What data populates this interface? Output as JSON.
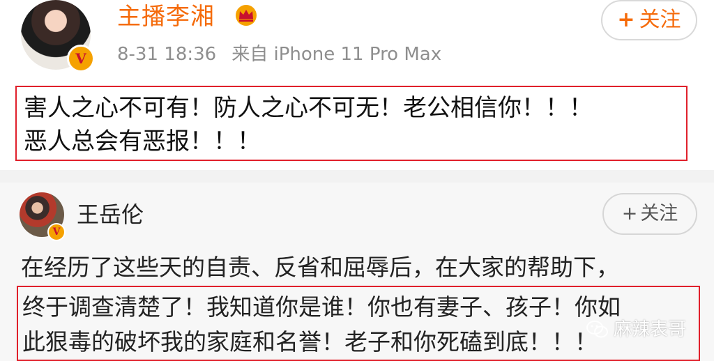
{
  "post1": {
    "username": "主播李湘",
    "date": "8-31 18:36",
    "source": "来自 iPhone 11 Pro Max",
    "follow_label": "关注",
    "follow_plus": "+",
    "badge_letter": "V",
    "text_lines": [
      "害人之心不可有！防人之心不可无！老公相信你！！！",
      "恶人总会有恶报！！！"
    ]
  },
  "post2": {
    "username": "王岳伦",
    "follow_label": "关注",
    "follow_plus": "+",
    "badge_letter": "V",
    "intro_line": "在经历了这些天的自责、反省和屈辱后，在大家的帮助下，",
    "highlight_lines": [
      "终于调查清楚了！我知道你是谁！你也有妻子、孩子！你如",
      "此狠毒的破坏我的家庭和名誉！老子和你死磕到底！！！"
    ]
  },
  "watermark": {
    "text": "麻辣表哥"
  },
  "colors": {
    "accent_orange": "#f56b0b",
    "highlight_red": "#e0202b",
    "verified_gold": "#f5a100"
  },
  "icons": {
    "crown": "crown-icon",
    "verified": "verified-badge-icon",
    "wechat": "wechat-icon"
  }
}
